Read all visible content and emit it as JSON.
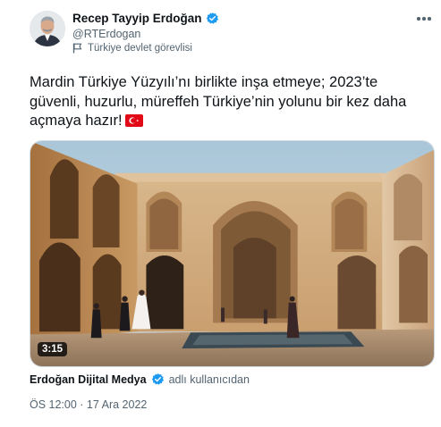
{
  "author": {
    "display_name": "Recep Tayyip Erdoğan",
    "handle": "@RTErdogan",
    "account_label": "Türkiye devlet görevlisi",
    "avatar": "portrait-photo",
    "verified_color": "#1d9bf0"
  },
  "tweet": {
    "text": "Mardin Türkiye Yüzyılı’nı birlikte inşa etmeye; 2023’te güvenli, huzurlu, müreffeh Türkiye’nin yolunu bir kez daha açmaya hazır!",
    "emoji": "turkey-flag"
  },
  "media": {
    "type": "video",
    "duration": "3:15",
    "scene": "stone courtyard with arched arcades, reflecting pool and wedding couple"
  },
  "attribution": {
    "name": "Erdoğan Dijital Medya",
    "suffix": "adlı kullanıcıdan"
  },
  "timestamp": "ÖS 12:00 · 17 Ara 2022",
  "colors": {
    "text_primary": "#0f1419",
    "text_secondary": "#536471",
    "verified_blue": "#1d9bf0",
    "border": "#cfd9de",
    "flag_red": "#e30a17"
  }
}
